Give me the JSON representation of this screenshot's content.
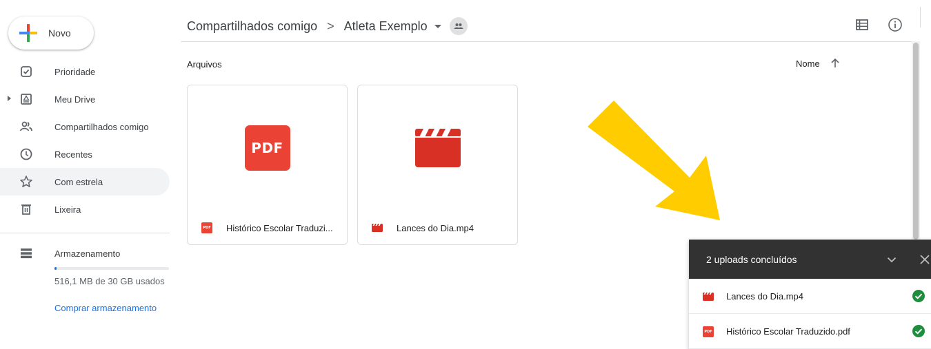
{
  "new_button": {
    "label": "Novo"
  },
  "nav": {
    "items": [
      {
        "label": "Prioridade",
        "icon": "check-square-icon"
      },
      {
        "label": "Meu Drive",
        "icon": "drive-icon"
      },
      {
        "label": "Compartilhados comigo",
        "icon": "people-icon"
      },
      {
        "label": "Recentes",
        "icon": "clock-icon"
      },
      {
        "label": "Com estrela",
        "icon": "star-icon"
      },
      {
        "label": "Lixeira",
        "icon": "trash-icon"
      }
    ],
    "selected": "Com estrela"
  },
  "storage": {
    "label": "Armazenamento",
    "usage_text": "516,1 MB de 30 GB usados",
    "used_fraction": 0.017,
    "buy_link": "Comprar armazenamento"
  },
  "breadcrumb": {
    "root": "Compartilhados comigo",
    "separator": ">",
    "current": "Atleta Exemplo"
  },
  "main": {
    "section_title": "Arquivos",
    "sort_label": "Nome",
    "files": [
      {
        "name": "Histórico Escolar Traduzi...",
        "type": "pdf",
        "thumb_text": "PDF"
      },
      {
        "name": "Lances do Dia.mp4",
        "type": "video"
      }
    ]
  },
  "upload_panel": {
    "title": "2 uploads concluídos",
    "items": [
      {
        "name": "Lances do Dia.mp4",
        "type": "video",
        "status": "done"
      },
      {
        "name": "Histórico Escolar Traduzido.pdf",
        "type": "pdf",
        "status": "done"
      }
    ]
  },
  "colors": {
    "accent": "#1a73e8",
    "pdf_red": "#ea4335",
    "video_red": "#d93025",
    "success_green": "#1e8e3e",
    "annotation_yellow": "#ffcc00",
    "panel_header": "#323232"
  }
}
